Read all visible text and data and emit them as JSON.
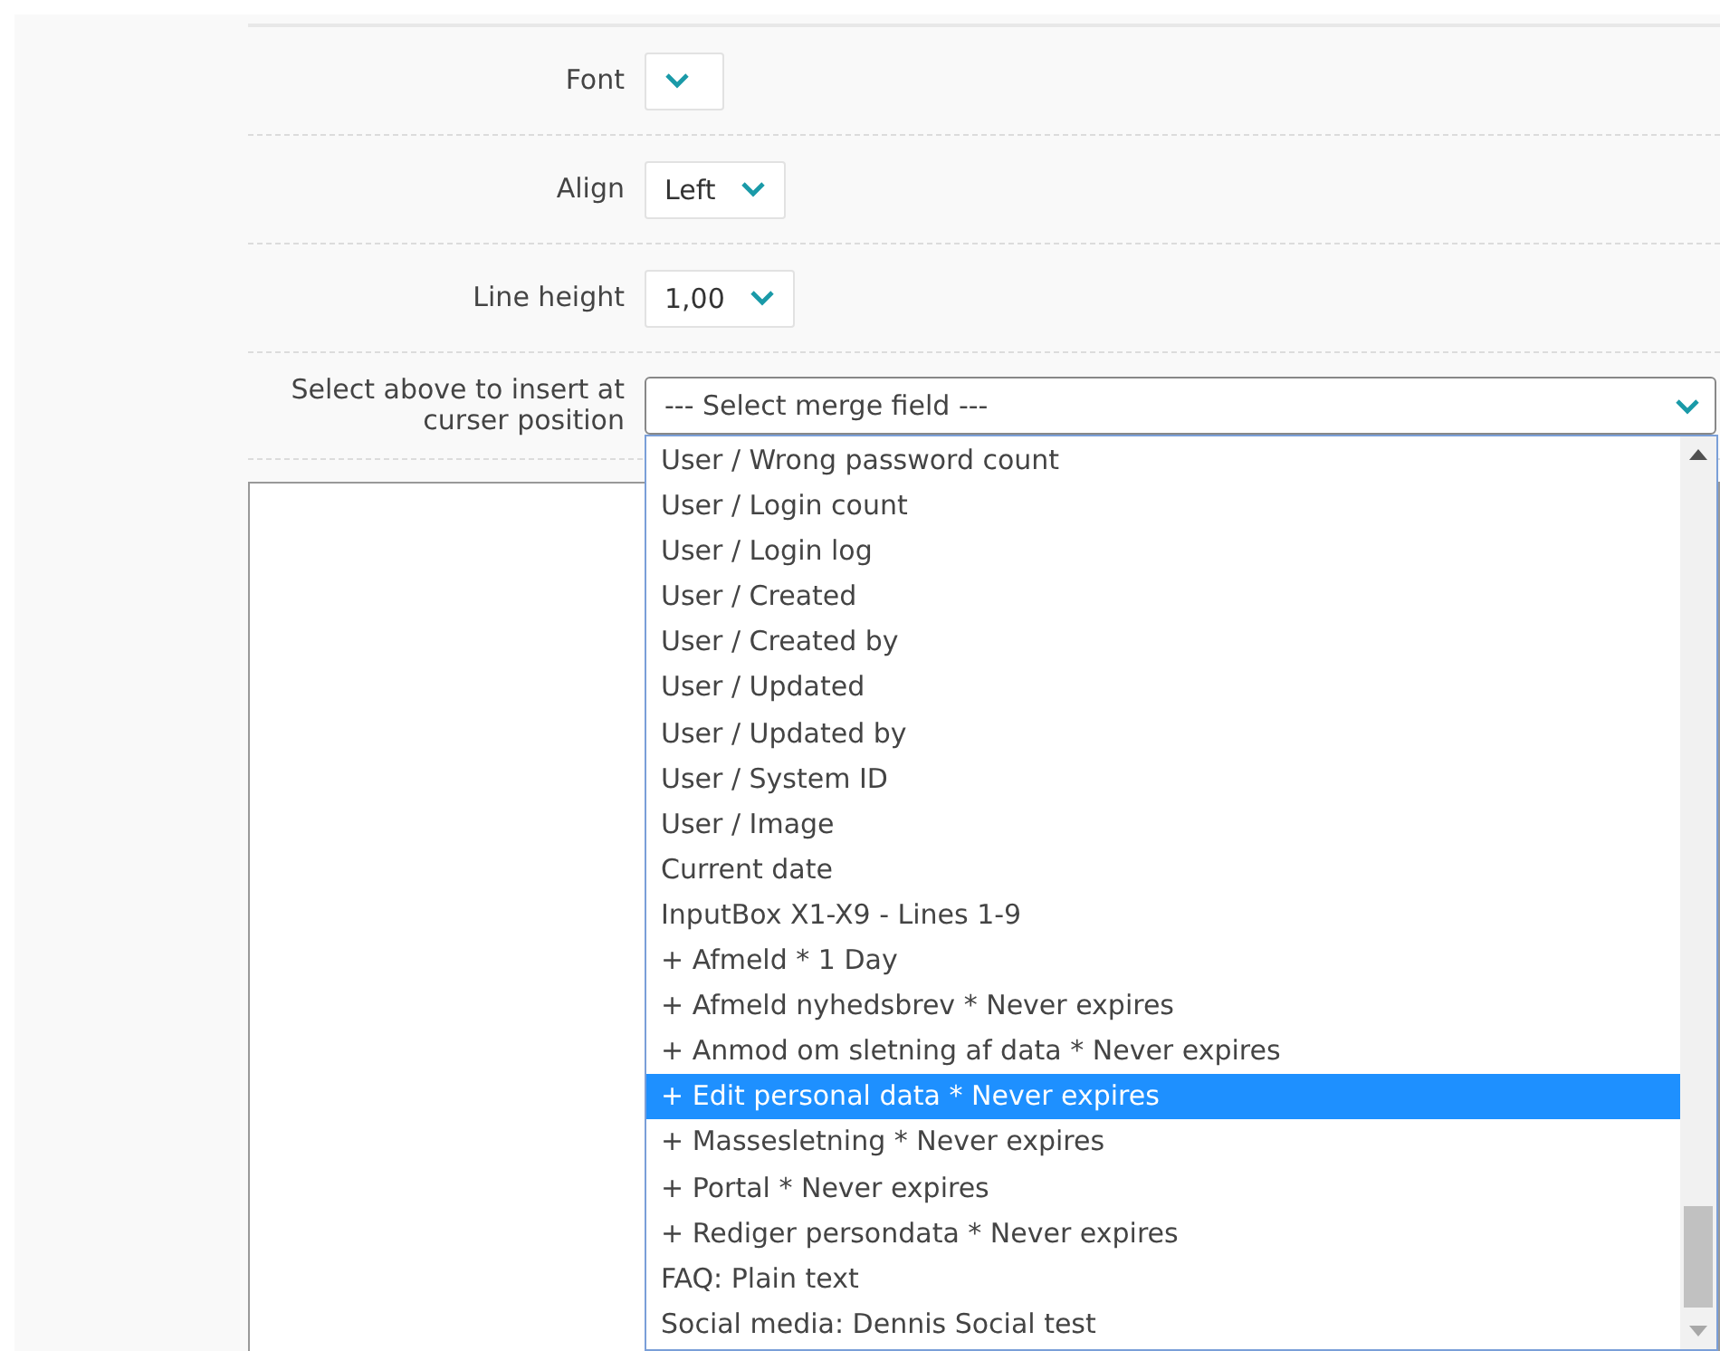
{
  "fields": [
    {
      "kind": "select",
      "label": "Font"
    },
    {
      "kind": "select",
      "label": "Align",
      "value": "Left"
    },
    {
      "kind": "select",
      "label": "Line height",
      "value": "1,00"
    },
    {
      "kind": "merge",
      "label": "Select above to insert at curser position",
      "value": "--- Select merge field ---",
      "expanded": true,
      "options": [
        {
          "label": "User / Wrong password count",
          "selected": false
        },
        {
          "label": "User / Login count",
          "selected": false
        },
        {
          "label": "User / Login log",
          "selected": false
        },
        {
          "label": "User / Created",
          "selected": false
        },
        {
          "label": "User / Created by",
          "selected": false
        },
        {
          "label": "User / Updated",
          "selected": false
        },
        {
          "label": "User / Updated by",
          "selected": false
        },
        {
          "label": "User / System ID",
          "selected": false
        },
        {
          "label": "User / Image",
          "selected": false
        },
        {
          "label": "Current date",
          "selected": false
        },
        {
          "label": "InputBox X1-X9 - Lines 1-9",
          "selected": false
        },
        {
          "label": "+ Afmeld * 1 Day",
          "selected": false
        },
        {
          "label": "+ Afmeld nyhedsbrev * Never expires",
          "selected": false
        },
        {
          "label": "+ Anmod om sletning af data * Never expires",
          "selected": false
        },
        {
          "label": "+ Edit personal data * Never expires",
          "selected": true
        },
        {
          "label": "+ Massesletning * Never expires",
          "selected": false
        },
        {
          "label": "+ Portal * Never expires",
          "selected": false
        },
        {
          "label": "+ Rediger persondata * Never expires",
          "selected": false
        },
        {
          "label": "FAQ: Plain text",
          "selected": false
        },
        {
          "label": "Social media: Dennis Social test",
          "selected": false
        }
      ]
    }
  ]
}
